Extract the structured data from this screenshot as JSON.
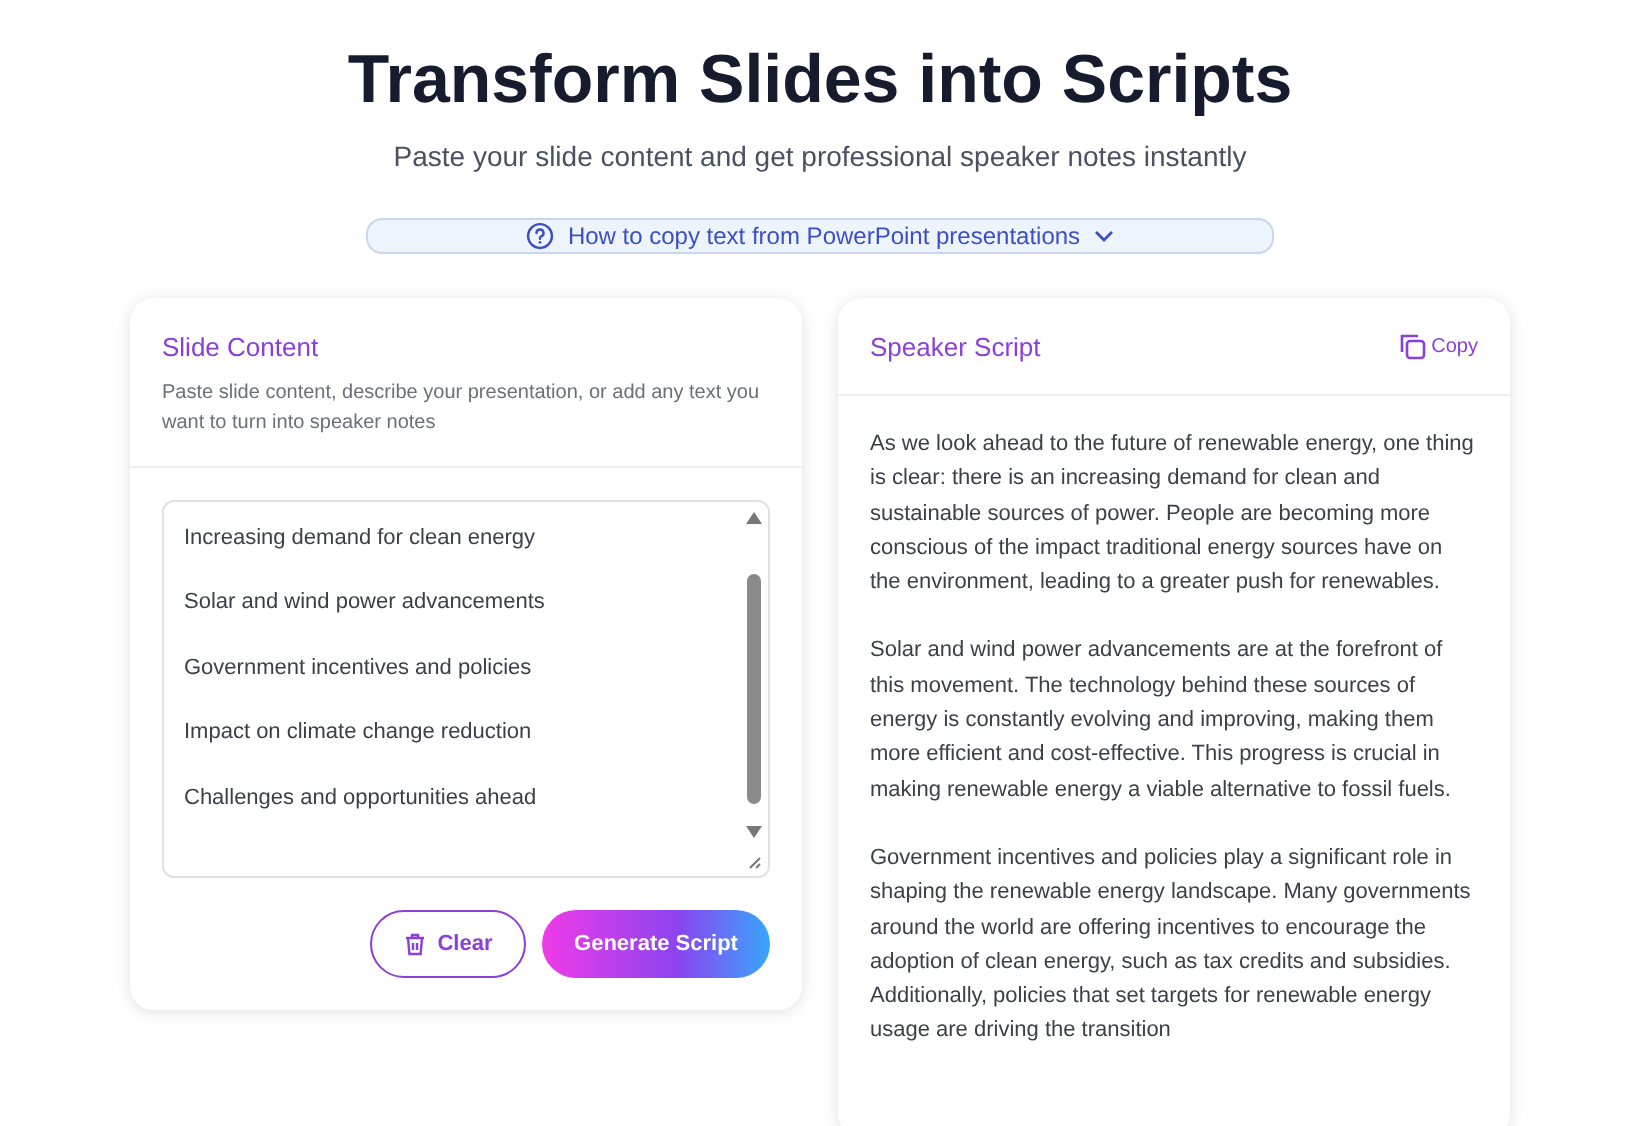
{
  "header": {
    "title": "Transform Slides into Scripts",
    "subtitle": "Paste your slide content and get professional speaker notes instantly"
  },
  "help_toggle": {
    "label": "How to copy text from PowerPoint presentations",
    "expanded": false
  },
  "input_panel": {
    "title": "Slide Content",
    "description": "Paste slide content, describe your presentation, or add any text you want to turn into speaker notes",
    "lines": [
      "Increasing demand for clean energy",
      "Solar and wind power advancements",
      "Government incentives and policies",
      "Impact on climate change reduction",
      "Challenges and opportunities ahead"
    ],
    "buttons": [
      {
        "kind": "secondary",
        "label": "Clear"
      },
      {
        "kind": "primary",
        "label": "Generate Script"
      }
    ]
  },
  "output_panel": {
    "title": "Speaker Script",
    "copy_label": "Copy",
    "paragraphs": [
      "As we look ahead to the future of renewable energy, one thing is clear: there is an increasing demand for clean and sustainable sources of power. People are becoming more conscious of the impact traditional energy sources have on the environment, leading to a greater push for renewables.",
      "Solar and wind power advancements are at the forefront of this movement. The technology behind these sources of energy is constantly evolving and improving, making them more efficient and cost-effective. This progress is crucial in making renewable energy a viable alternative to fossil fuels.",
      "Government incentives and policies play a significant role in shaping the renewable energy landscape. Many governments around the world are offering incentives to encourage the adoption of clean energy, such as tax credits and subsidies. Additionally, policies that set targets for renewable energy usage are driving the transition"
    ]
  }
}
